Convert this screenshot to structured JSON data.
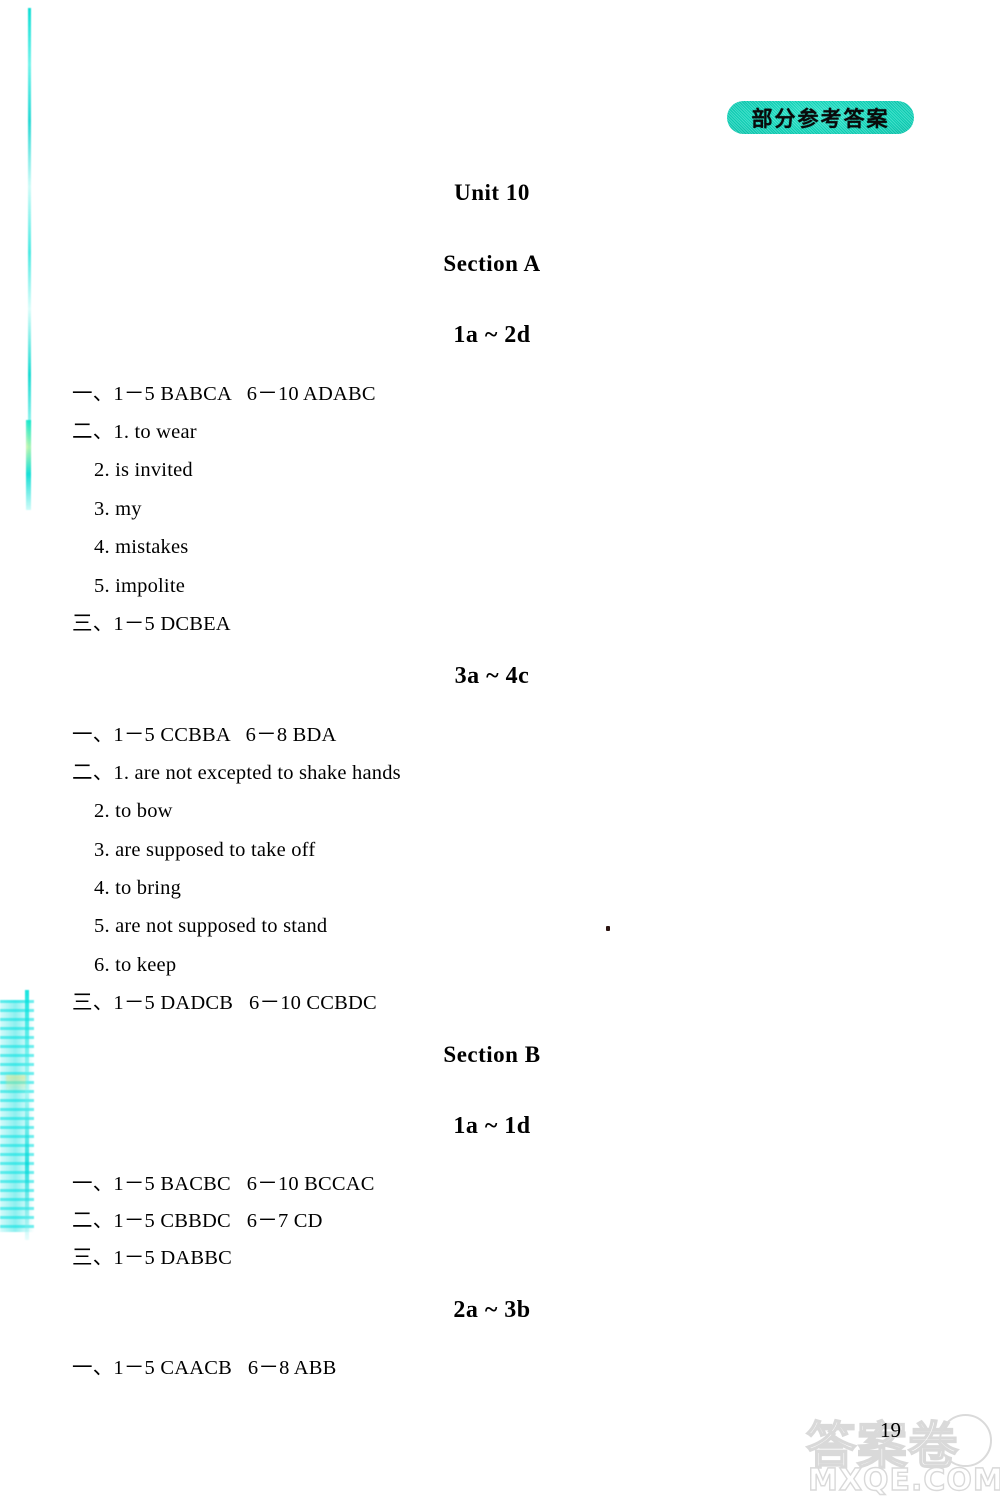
{
  "header": {
    "badge_label": "部分参考答案"
  },
  "document": {
    "unit_title": "Unit 10",
    "sections": [
      {
        "section_title": "Section A",
        "groups": [
          {
            "group_title": "1a ~ 2d",
            "lines": [
              {
                "text": "一、1－5 BABCA   6－10 ADABC",
                "indent": false
              },
              {
                "text": "二、1. to wear",
                "indent": false
              },
              {
                "text": "2. is invited",
                "indent": true
              },
              {
                "text": "3. my",
                "indent": true
              },
              {
                "text": "4. mistakes",
                "indent": true
              },
              {
                "text": "5. impolite",
                "indent": true
              },
              {
                "text": "三、1－5 DCBEA",
                "indent": false
              }
            ]
          },
          {
            "group_title": "3a ~ 4c",
            "lines": [
              {
                "text": "一、1－5 CCBBA   6－8 BDA",
                "indent": false
              },
              {
                "text": "二、1. are not excepted to shake hands",
                "indent": false
              },
              {
                "text": "2. to bow",
                "indent": true
              },
              {
                "text": "3. are supposed to take off",
                "indent": true
              },
              {
                "text": "4. to bring",
                "indent": true
              },
              {
                "text": "5. are not supposed to stand",
                "indent": true
              },
              {
                "text": "6. to keep",
                "indent": true
              },
              {
                "text": "三、1－5 DADCB   6－10 CCBDC",
                "indent": false
              }
            ]
          }
        ]
      },
      {
        "section_title": "Section B",
        "groups": [
          {
            "group_title": "1a ~ 1d",
            "lines": [
              {
                "text": "一、1－5 BACBC   6－10 BCCAC",
                "indent": false
              },
              {
                "text": "二、1－5 CBBDC   6－7 CD",
                "indent": false
              },
              {
                "text": "三、1－5 DABBC",
                "indent": false
              }
            ]
          },
          {
            "group_title": "2a ~ 3b",
            "lines": [
              {
                "text": "一、1－5 CAACB   6－8 ABB",
                "indent": false
              }
            ]
          }
        ]
      }
    ]
  },
  "footer": {
    "page_number": "19",
    "watermark_cjk": "答案卷",
    "watermark_domain": "MXQE.COM"
  },
  "colors": {
    "badge_teal": "#0fd9bd",
    "scan_artifact_cyan": "#00dcd2",
    "text_black": "#000000",
    "watermark_gray": "#d9d9d9"
  }
}
